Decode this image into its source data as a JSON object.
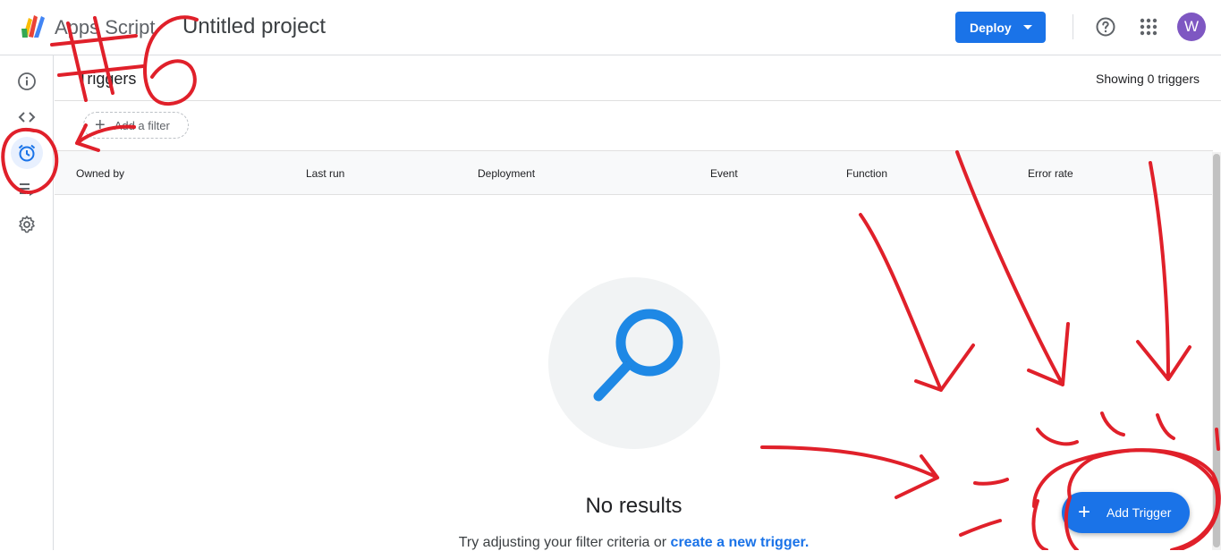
{
  "header": {
    "app_name": "Apps Script",
    "project_title": "Untitled project",
    "deploy_label": "Deploy",
    "avatar_initial": "W"
  },
  "sidebar": {
    "items": [
      {
        "name": "overview",
        "icon": "info-icon"
      },
      {
        "name": "editor",
        "icon": "code-icon"
      },
      {
        "name": "triggers",
        "icon": "alarm-clock-icon",
        "active": true
      },
      {
        "name": "executions",
        "icon": "executions-list-icon"
      },
      {
        "name": "settings",
        "icon": "gear-icon"
      }
    ]
  },
  "main": {
    "title": "Triggers",
    "showing": "Showing 0 triggers",
    "filter_label": "Add a filter",
    "columns": [
      "Owned by",
      "Last run",
      "Deployment",
      "Event",
      "Function",
      "Error rate"
    ],
    "empty_title": "No results",
    "empty_hint": "Try adjusting your filter criteria or",
    "empty_link": "create a new trigger."
  },
  "fab": {
    "label": "Add Trigger"
  },
  "annotation": {
    "text": "#6",
    "color": "#e0202a"
  },
  "colors": {
    "accent": "#1a73e8",
    "avatar": "#7e57c2"
  }
}
